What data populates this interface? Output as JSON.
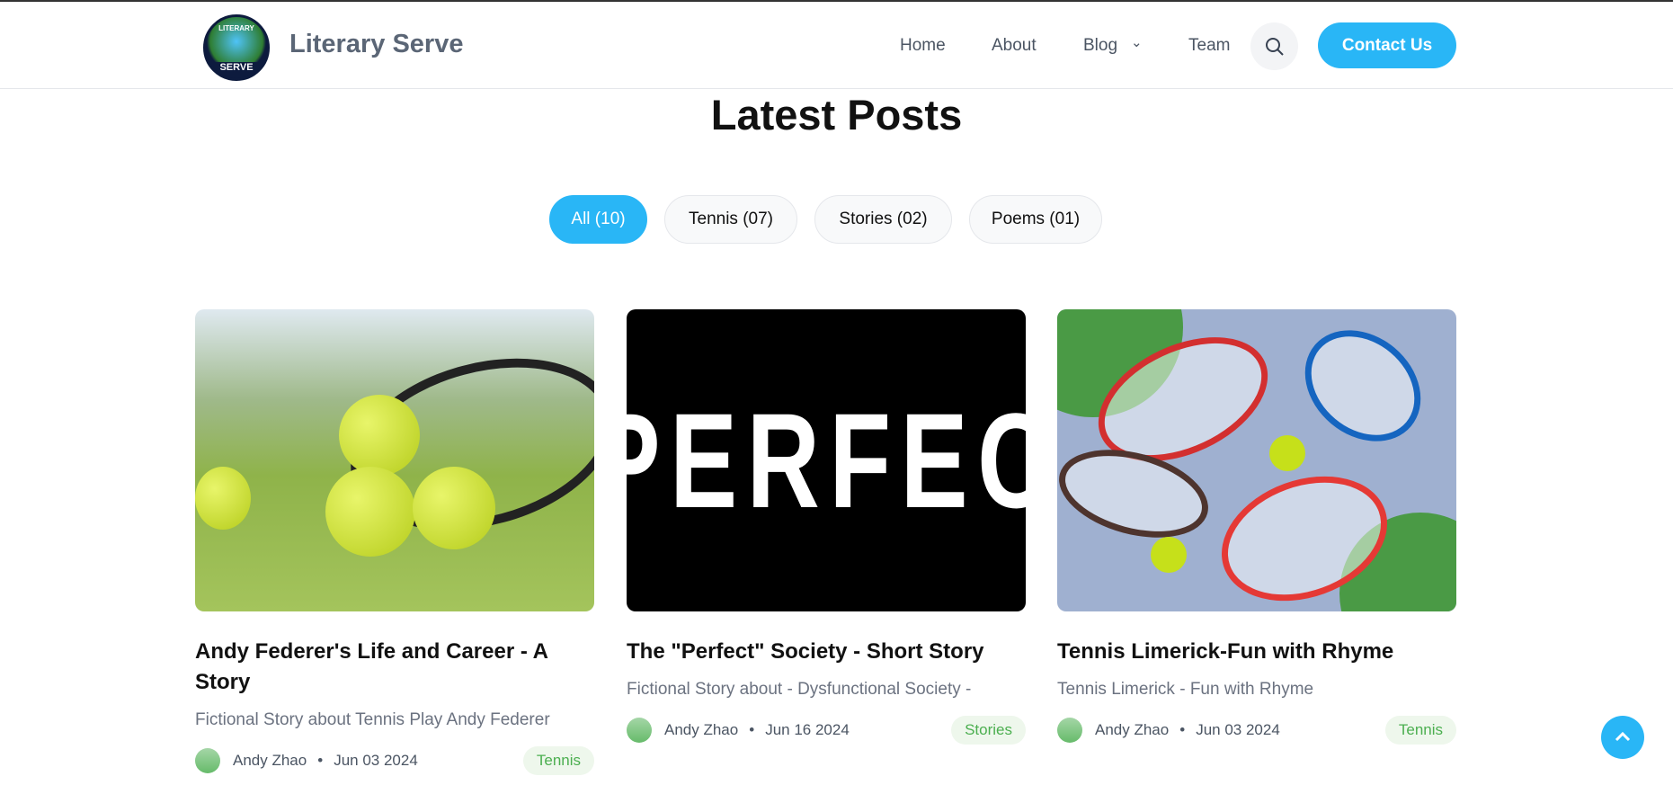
{
  "header": {
    "brand": "Literary Serve",
    "logo_text_top": "LITERARY",
    "logo_text_mid": "SERVE",
    "nav": [
      "Home",
      "About",
      "Blog",
      "Team"
    ],
    "contact": "Contact Us"
  },
  "main": {
    "title": "Latest Posts",
    "filters": [
      "All (10)",
      "Tennis (07)",
      "Stories (02)",
      "Poems (01)"
    ]
  },
  "posts": [
    {
      "title": "Andy Federer's Life and Career - A Story",
      "desc": "Fictional Story about Tennis Play Andy Federer",
      "author": "Andy Zhao",
      "date": "Jun 03 2024",
      "tag": "Tennis"
    },
    {
      "title": "The \"Perfect\" Society - Short Story",
      "desc": "Fictional Story about - Dysfunctional Society -",
      "author": "Andy Zhao",
      "date": "Jun 16 2024",
      "tag": "Stories",
      "image_text": "PERFEC"
    },
    {
      "title": "Tennis Limerick-Fun with Rhyme",
      "desc": "Tennis Limerick - Fun with Rhyme",
      "author": "Andy Zhao",
      "date": "Jun 03 2024",
      "tag": "Tennis"
    }
  ],
  "colors": {
    "accent": "#29b6f6",
    "tag_text": "#4caf50"
  }
}
